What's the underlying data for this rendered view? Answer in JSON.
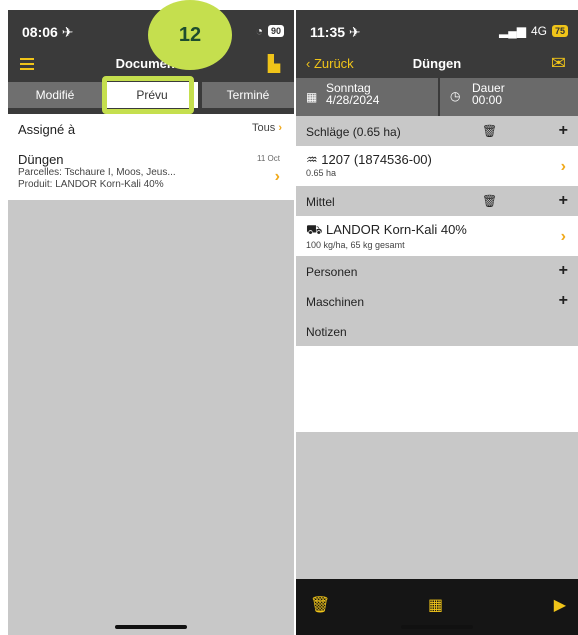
{
  "left": {
    "status": {
      "time": "08:06 ✈",
      "battery": "90"
    },
    "nav": {
      "title": "Documents"
    },
    "tabs": [
      {
        "label": "Modifié"
      },
      {
        "label": "Prévu"
      },
      {
        "label": "Terminé"
      }
    ],
    "badge": "12",
    "assigne": {
      "label": "Assigné à",
      "value": "Tous"
    },
    "item": {
      "title": "Düngen",
      "date": "11 Oct",
      "line1": "Parcelles: Tschaure I, Moos, Jeus...",
      "line2": "Produit: LANDOR Korn-Kali 40%"
    }
  },
  "right": {
    "status": {
      "time": "11:35 ✈",
      "signal": "4G",
      "battery": "75"
    },
    "nav": {
      "back": "Zurück",
      "title": "Düngen"
    },
    "date": {
      "day": "Sonntag",
      "value": "4/28/2024"
    },
    "duration": {
      "label": "Dauer",
      "value": "00:00"
    },
    "sections": {
      "schlaege": "Schläge (0.65 ha)",
      "mittel": "Mittel",
      "personen": "Personen",
      "maschinen": "Maschinen",
      "notizen": "Notizen"
    },
    "schlag_item": {
      "title": "1207 (1874536-00)",
      "sub": "0.65 ha"
    },
    "mittel_item": {
      "title": "LANDOR Korn-Kali 40%",
      "sub": "100 kg/ha, 65 kg gesamt"
    }
  },
  "accent": "#f0c419",
  "highlight_color": "#c5df4e"
}
